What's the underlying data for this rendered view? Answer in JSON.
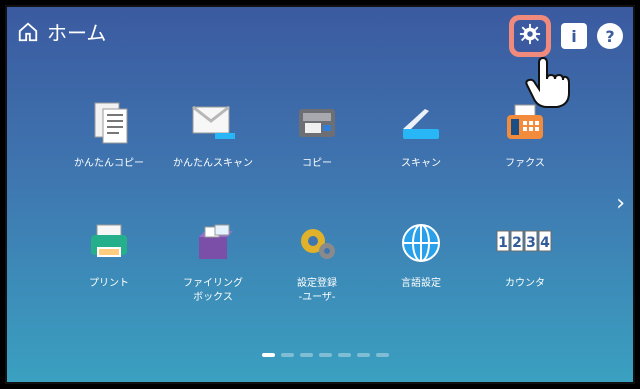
{
  "header": {
    "title": "ホーム"
  },
  "top_icons": {
    "gear": "gear-icon",
    "info": "info-icon",
    "help": "help-icon"
  },
  "tiles": [
    {
      "label": "かんたんコピー",
      "icon": "easy-copy-icon"
    },
    {
      "label": "かんたんスキャン",
      "icon": "easy-scan-icon"
    },
    {
      "label": "コピー",
      "icon": "copy-icon"
    },
    {
      "label": "スキャン",
      "icon": "scan-icon"
    },
    {
      "label": "ファクス",
      "icon": "fax-icon"
    },
    {
      "label": "プリント",
      "icon": "print-icon"
    },
    {
      "label": "ファイリング\nボックス",
      "icon": "filing-box-icon"
    },
    {
      "label": "設定登録\n-ユーザ-",
      "icon": "settings-user-icon"
    },
    {
      "label": "言語設定",
      "icon": "language-settings-icon"
    },
    {
      "label": "カウンタ",
      "icon": "counter-icon"
    }
  ],
  "pager": {
    "total": 7,
    "active": 0
  },
  "colors": {
    "bg_top": "#3b5aa0",
    "bg_bottom": "#3aa0c0",
    "highlight": "#f08a7c"
  }
}
